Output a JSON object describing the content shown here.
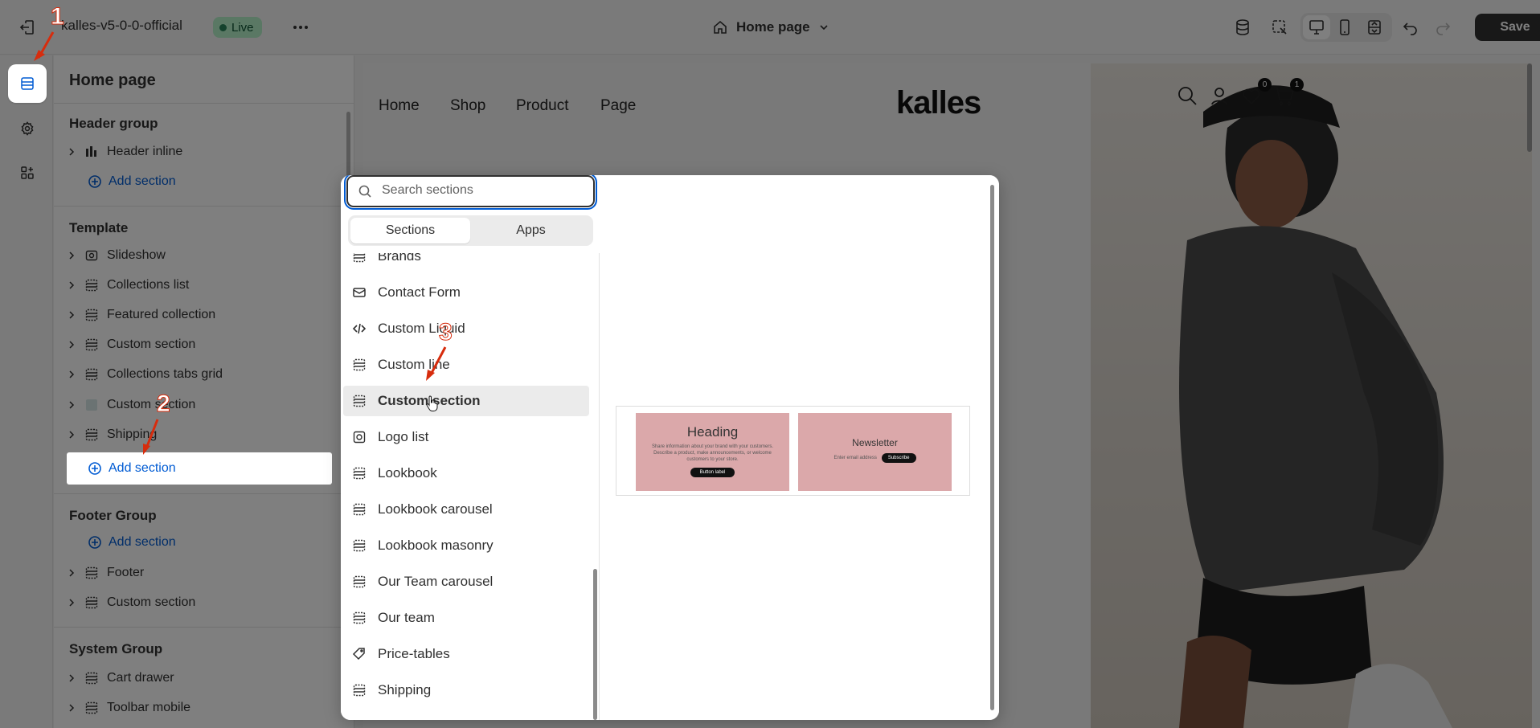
{
  "topbar": {
    "store_name": "kalles-v5-0-0-official",
    "live_badge": "Live",
    "page_selector": "Home page",
    "save_label": "Save"
  },
  "sidebar": {
    "title": "Home page",
    "header_group": {
      "title": "Header group",
      "items": [
        "Header inline"
      ],
      "add_label": "Add section"
    },
    "template": {
      "title": "Template",
      "items": [
        "Slideshow",
        "Collections list",
        "Featured collection",
        "Custom section",
        "Collections tabs grid",
        "Custom section",
        "Shipping"
      ],
      "add_label": "Add section"
    },
    "footer_group": {
      "title": "Footer Group",
      "add_label": "Add section",
      "items": [
        "Footer",
        "Custom section"
      ]
    },
    "system_group": {
      "title": "System Group",
      "items": [
        "Cart drawer",
        "Toolbar mobile"
      ]
    }
  },
  "picker": {
    "search_placeholder": "Search sections",
    "tabs": [
      "Sections",
      "Apps"
    ],
    "active_tab": "Sections",
    "items": [
      {
        "label": "Brands",
        "icon": "section-icon"
      },
      {
        "label": "Contact Form",
        "icon": "mail-icon"
      },
      {
        "label": "Custom Liquid",
        "icon": "code-icon"
      },
      {
        "label": "Custom line",
        "icon": "section-icon"
      },
      {
        "label": "Custom section",
        "icon": "section-icon"
      },
      {
        "label": "Logo list",
        "icon": "logo-list-icon"
      },
      {
        "label": "Lookbook",
        "icon": "section-icon"
      },
      {
        "label": "Lookbook carousel",
        "icon": "section-icon"
      },
      {
        "label": "Lookbook masonry",
        "icon": "section-icon"
      },
      {
        "label": "Our Team carousel",
        "icon": "section-icon"
      },
      {
        "label": "Our team",
        "icon": "section-icon"
      },
      {
        "label": "Price-tables",
        "icon": "price-tag-icon"
      },
      {
        "label": "Shipping",
        "icon": "section-icon"
      }
    ],
    "hovered_item": "Custom section",
    "preview": {
      "card1_heading": "Heading",
      "card1_text": "Share information about your brand with your customers. Describe a product, make announcements, or welcome customers to your store.",
      "card1_button": "Button label",
      "card2_heading": "Newsletter",
      "card2_input": "Enter email address",
      "card2_button": "Subscribe"
    }
  },
  "storefront": {
    "nav": [
      "Home",
      "Shop",
      "Product",
      "Page"
    ],
    "logo": "kalles",
    "wishlist_count": "0",
    "cart_count": "1"
  },
  "annotations": {
    "step1": "1",
    "step2": "2",
    "step3": "3"
  },
  "colors": {
    "accent": "#005bd3",
    "live_badge_bg": "#b4f0c9",
    "save_bg": "#303030",
    "annotation": "#d72c0d"
  }
}
